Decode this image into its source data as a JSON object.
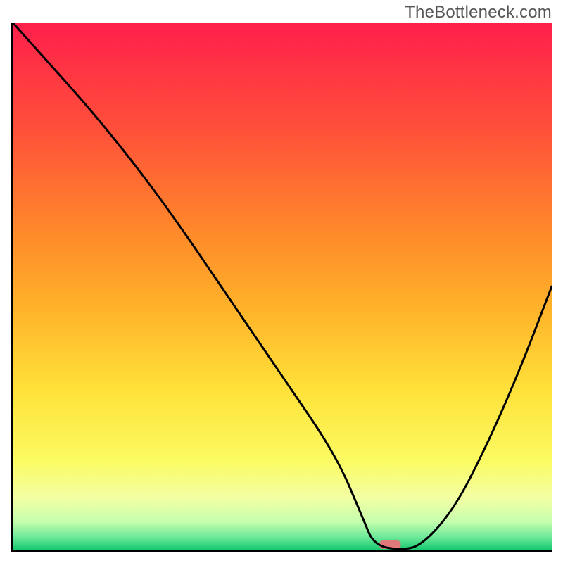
{
  "watermark": "TheBottleneck.com",
  "chart_data": {
    "type": "line",
    "title": "",
    "xlabel": "",
    "ylabel": "",
    "xlim": [
      0,
      100
    ],
    "ylim": [
      0,
      100
    ],
    "series": [
      {
        "name": "curve",
        "x": [
          0,
          7,
          14,
          22,
          30,
          40,
          50,
          60,
          65,
          67,
          72,
          76,
          82,
          88,
          94,
          100
        ],
        "values": [
          100,
          92,
          84,
          74,
          63,
          48,
          33,
          18,
          6,
          1,
          0,
          1,
          8,
          20,
          34,
          50
        ]
      }
    ],
    "marker": {
      "x": 70,
      "width": 4,
      "color": "#e07a7a"
    },
    "gradient_stops": [
      {
        "offset": 0.0,
        "color": "#ff1f4b"
      },
      {
        "offset": 0.2,
        "color": "#ff4f3a"
      },
      {
        "offset": 0.4,
        "color": "#ff8a2a"
      },
      {
        "offset": 0.55,
        "color": "#ffb52a"
      },
      {
        "offset": 0.7,
        "color": "#ffe23a"
      },
      {
        "offset": 0.83,
        "color": "#fbfb62"
      },
      {
        "offset": 0.9,
        "color": "#f3ffa3"
      },
      {
        "offset": 0.945,
        "color": "#c7ffae"
      },
      {
        "offset": 0.975,
        "color": "#6de89a"
      },
      {
        "offset": 1.0,
        "color": "#11c76c"
      }
    ]
  }
}
